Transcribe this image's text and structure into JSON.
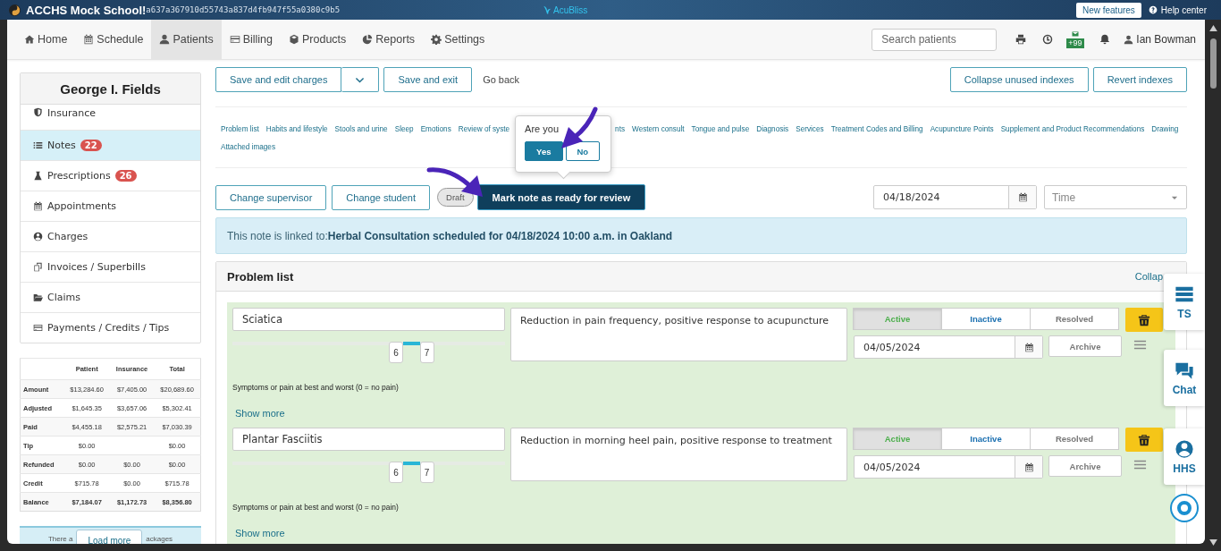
{
  "top_bar": {
    "school": "ACCHS Mock School!",
    "hash": "a637a367910d55743a837d4fb947f55a0380c9b5",
    "brand": "AcuBliss",
    "new_features": "New features",
    "help": "Help center"
  },
  "nav": {
    "items": [
      {
        "label": "Home",
        "selected": false
      },
      {
        "label": "Schedule",
        "selected": false
      },
      {
        "label": "Patients",
        "selected": true
      },
      {
        "label": "Billing",
        "selected": false
      },
      {
        "label": "Products",
        "selected": false
      },
      {
        "label": "Reports",
        "selected": false
      },
      {
        "label": "Settings",
        "selected": false
      }
    ],
    "search": {
      "placeholder": "Search patients"
    },
    "mail_badge": "+99",
    "user": "Ian Bowman"
  },
  "sidebar": {
    "patient": "George I. Fields",
    "items": [
      {
        "label": "Insurance",
        "selected": false
      },
      {
        "label": "Notes",
        "badge": "22",
        "selected": true
      },
      {
        "label": "Prescriptions",
        "badge": "26",
        "selected": false
      },
      {
        "label": "Appointments",
        "selected": false
      },
      {
        "label": "Charges",
        "selected": false
      },
      {
        "label": "Invoices / Superbills",
        "selected": false
      },
      {
        "label": "Claims",
        "selected": false
      },
      {
        "label": "Payments / Credits / Tips",
        "selected": false
      }
    ],
    "summary": {
      "columns": [
        "Patient",
        "Insurance",
        "Total"
      ],
      "rows": [
        {
          "kind": "row",
          "label": "Amount",
          "patient": "$13,284.60",
          "insurance": "$7,405.00",
          "total": "$20,689.60"
        },
        {
          "kind": "row",
          "label": "Adjusted",
          "patient": "$1,645.35",
          "insurance": "$3,657.06",
          "total": "$5,302.41"
        },
        {
          "kind": "row",
          "label": "Paid",
          "patient": "$4,455.18",
          "insurance": "$2,575.21",
          "total": "$7,030.39"
        },
        {
          "kind": "row",
          "label": "Tip",
          "patient": "$0.00",
          "total": "$0.00"
        },
        {
          "kind": "row",
          "label": "Refunded",
          "patient": "$0.00",
          "insurance": "$0.00",
          "total": "$0.00"
        },
        {
          "kind": "row",
          "label": "Credit",
          "patient": "$715.78",
          "insurance": "$0.00",
          "total": "$715.78"
        },
        {
          "kind": "total",
          "label": "Balance",
          "patient": "$7,184.07",
          "insurance": "$1,172.73",
          "total": "$8,356.80"
        }
      ]
    },
    "packages_note": {
      "left": "There a",
      "right": "ackages"
    },
    "load_more": "Load more"
  },
  "toolbar": {
    "left": [
      "Save and edit charges",
      "Save and exit"
    ],
    "go_back": "Go back",
    "right": [
      "Collapse unused indexes",
      "Revert indexes"
    ]
  },
  "index_links": [
    {
      "kind": "link",
      "label": "Problem list"
    },
    {
      "kind": "link",
      "label": "Habits and lifestyle"
    },
    {
      "kind": "link",
      "label": "Stools and urine"
    },
    {
      "kind": "link",
      "label": "Sleep"
    },
    {
      "kind": "link",
      "label": "Emotions"
    },
    {
      "kind": "link",
      "label": "Review of syste"
    },
    {
      "kind": "popover",
      "title": "Are you",
      "buttons": [
        {
          "label": "Yes",
          "primary": true
        },
        {
          "label": "No",
          "primary": false
        }
      ]
    },
    {
      "kind": "link",
      "label": "nts"
    },
    {
      "kind": "link",
      "label": "Western consult"
    },
    {
      "kind": "link",
      "label": "Tongue and pulse"
    },
    {
      "kind": "link",
      "label": "Diagnosis"
    },
    {
      "kind": "link",
      "label": "Services"
    },
    {
      "kind": "link",
      "label": "Treatment Codes and Billing"
    },
    {
      "kind": "link",
      "label": "Acupuncture Points"
    },
    {
      "kind": "link",
      "label": "Supplement and Product Recommendations"
    },
    {
      "kind": "link",
      "label": "Drawing"
    },
    {
      "kind": "link",
      "label": "Attached images"
    }
  ],
  "note_actions": {
    "buttons": [
      "Change supervisor",
      "Change student"
    ],
    "status": "Draft",
    "mark_ready": "Mark note as ready for review",
    "date": "04/18/2024",
    "time_placeholder": "Time"
  },
  "linked_alert": {
    "prefix": "This note is linked to: ",
    "link": "Herbal Consultation scheduled for 04/18/2024 10:00 a.m. in Oakland"
  },
  "problem_list": {
    "title": "Problem list",
    "collapse": "Collap",
    "problems": [
      {
        "name": "Sciatica",
        "goal": "Reduction in pain frequency, positive response to acupuncture",
        "statuses": [
          {
            "label": "Active",
            "selected": true
          },
          {
            "label": "Inactive",
            "selected": false
          },
          {
            "label": "Resolved",
            "selected": false
          }
        ],
        "date": "04/05/2024",
        "archive": "Archive",
        "best": {
          "level": 0.6,
          "reading": "6"
        },
        "worst": {
          "level": 0.7,
          "reading": "7"
        },
        "scale_label": "Symptoms or pain at best and worst (0 = no pain)",
        "show_more": "Show more"
      },
      {
        "name": "Plantar Fasciitis",
        "goal": "Reduction in morning heel pain, positive response to treatment",
        "statuses": [
          {
            "label": "Active",
            "selected": true
          },
          {
            "label": "Inactive",
            "selected": false
          },
          {
            "label": "Resolved",
            "selected": false
          }
        ],
        "date": "04/05/2024",
        "archive": "Archive",
        "best": {
          "level": 0.6,
          "reading": "6"
        },
        "worst": {
          "level": 0.7,
          "reading": "7"
        },
        "scale_label": "Symptoms or pain at best and worst (0 = no pain)",
        "show_more": "Show more"
      }
    ]
  },
  "side_tabs": [
    "TS",
    "Chat",
    "HHS"
  ]
}
